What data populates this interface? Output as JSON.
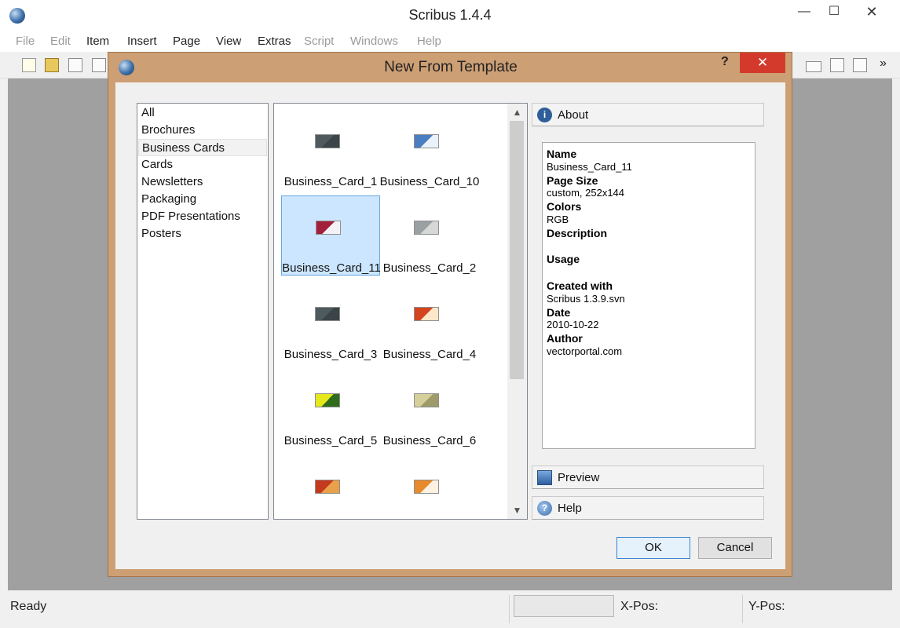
{
  "app": {
    "title": "Scribus 1.4.4",
    "window_controls": {
      "minimize": "—",
      "maximize": "☐",
      "close": "✕"
    },
    "menu": [
      "File",
      "Edit",
      "Item",
      "Insert",
      "Page",
      "View",
      "Extras",
      "Script",
      "Windows",
      "Help"
    ],
    "toolbar_icons": [
      "new-document-icon",
      "open-icon",
      "save-icon",
      "close-document-icon",
      "ok-icon",
      "text-icon",
      "check-icon"
    ],
    "toolbar_more": "»"
  },
  "dialog": {
    "title": "New From Template",
    "help_glyph": "?",
    "close_glyph": "✕",
    "categories": [
      "All",
      "Brochures",
      "Business Cards",
      "Cards",
      "Newsletters",
      "Packaging",
      "PDF Presentations",
      "Posters"
    ],
    "selected_category": "Business Cards",
    "templates": [
      {
        "label": "Business_Card_1",
        "colors": [
          "#505a5e",
          "#3b4447"
        ]
      },
      {
        "label": "Business_Card_10",
        "colors": [
          "#4a7ec0",
          "#e9f2fa"
        ]
      },
      {
        "label": "Business_Card_11",
        "colors": [
          "#a3203a",
          "#f3f3f7"
        ]
      },
      {
        "label": "Business_Card_2",
        "colors": [
          "#9aa1a2",
          "#d6d8d6"
        ]
      },
      {
        "label": "Business_Card_3",
        "colors": [
          "#4d5a5e",
          "#3b4447"
        ]
      },
      {
        "label": "Business_Card_4",
        "colors": [
          "#d4451d",
          "#fce7c8"
        ]
      },
      {
        "label": "Business_Card_5",
        "colors": [
          "#e5e81b",
          "#2f6d1c"
        ]
      },
      {
        "label": "Business_Card_6",
        "colors": [
          "#d6cf9c",
          "#9e9a6a"
        ]
      },
      {
        "label": "",
        "colors": [
          "#c43a1e",
          "#e8a04a"
        ]
      },
      {
        "label": "",
        "colors": [
          "#e78a2c",
          "#fdf1e2"
        ]
      }
    ],
    "selected_template": "Business_Card_11",
    "scroll": {
      "up": "▲",
      "down": "▼"
    },
    "about_label": "About",
    "preview_label": "Preview",
    "help_label": "Help",
    "info": {
      "name_label": "Name",
      "name": "Business_Card_11",
      "page_size_label": "Page Size",
      "page_size": "custom, 252x144",
      "colors_label": "Colors",
      "colors": "RGB",
      "description_label": "Description",
      "description": "",
      "usage_label": "Usage",
      "usage": "",
      "created_with_label": "Created with",
      "created_with": "Scribus 1.3.9.svn",
      "date_label": "Date",
      "date": "2010-10-22",
      "author_label": "Author",
      "author": "vectorportal.com"
    },
    "ok_label": "OK",
    "cancel_label": "Cancel"
  },
  "status": {
    "text": "Ready",
    "xpos_label": "X-Pos:",
    "ypos_label": "Y-Pos:"
  }
}
